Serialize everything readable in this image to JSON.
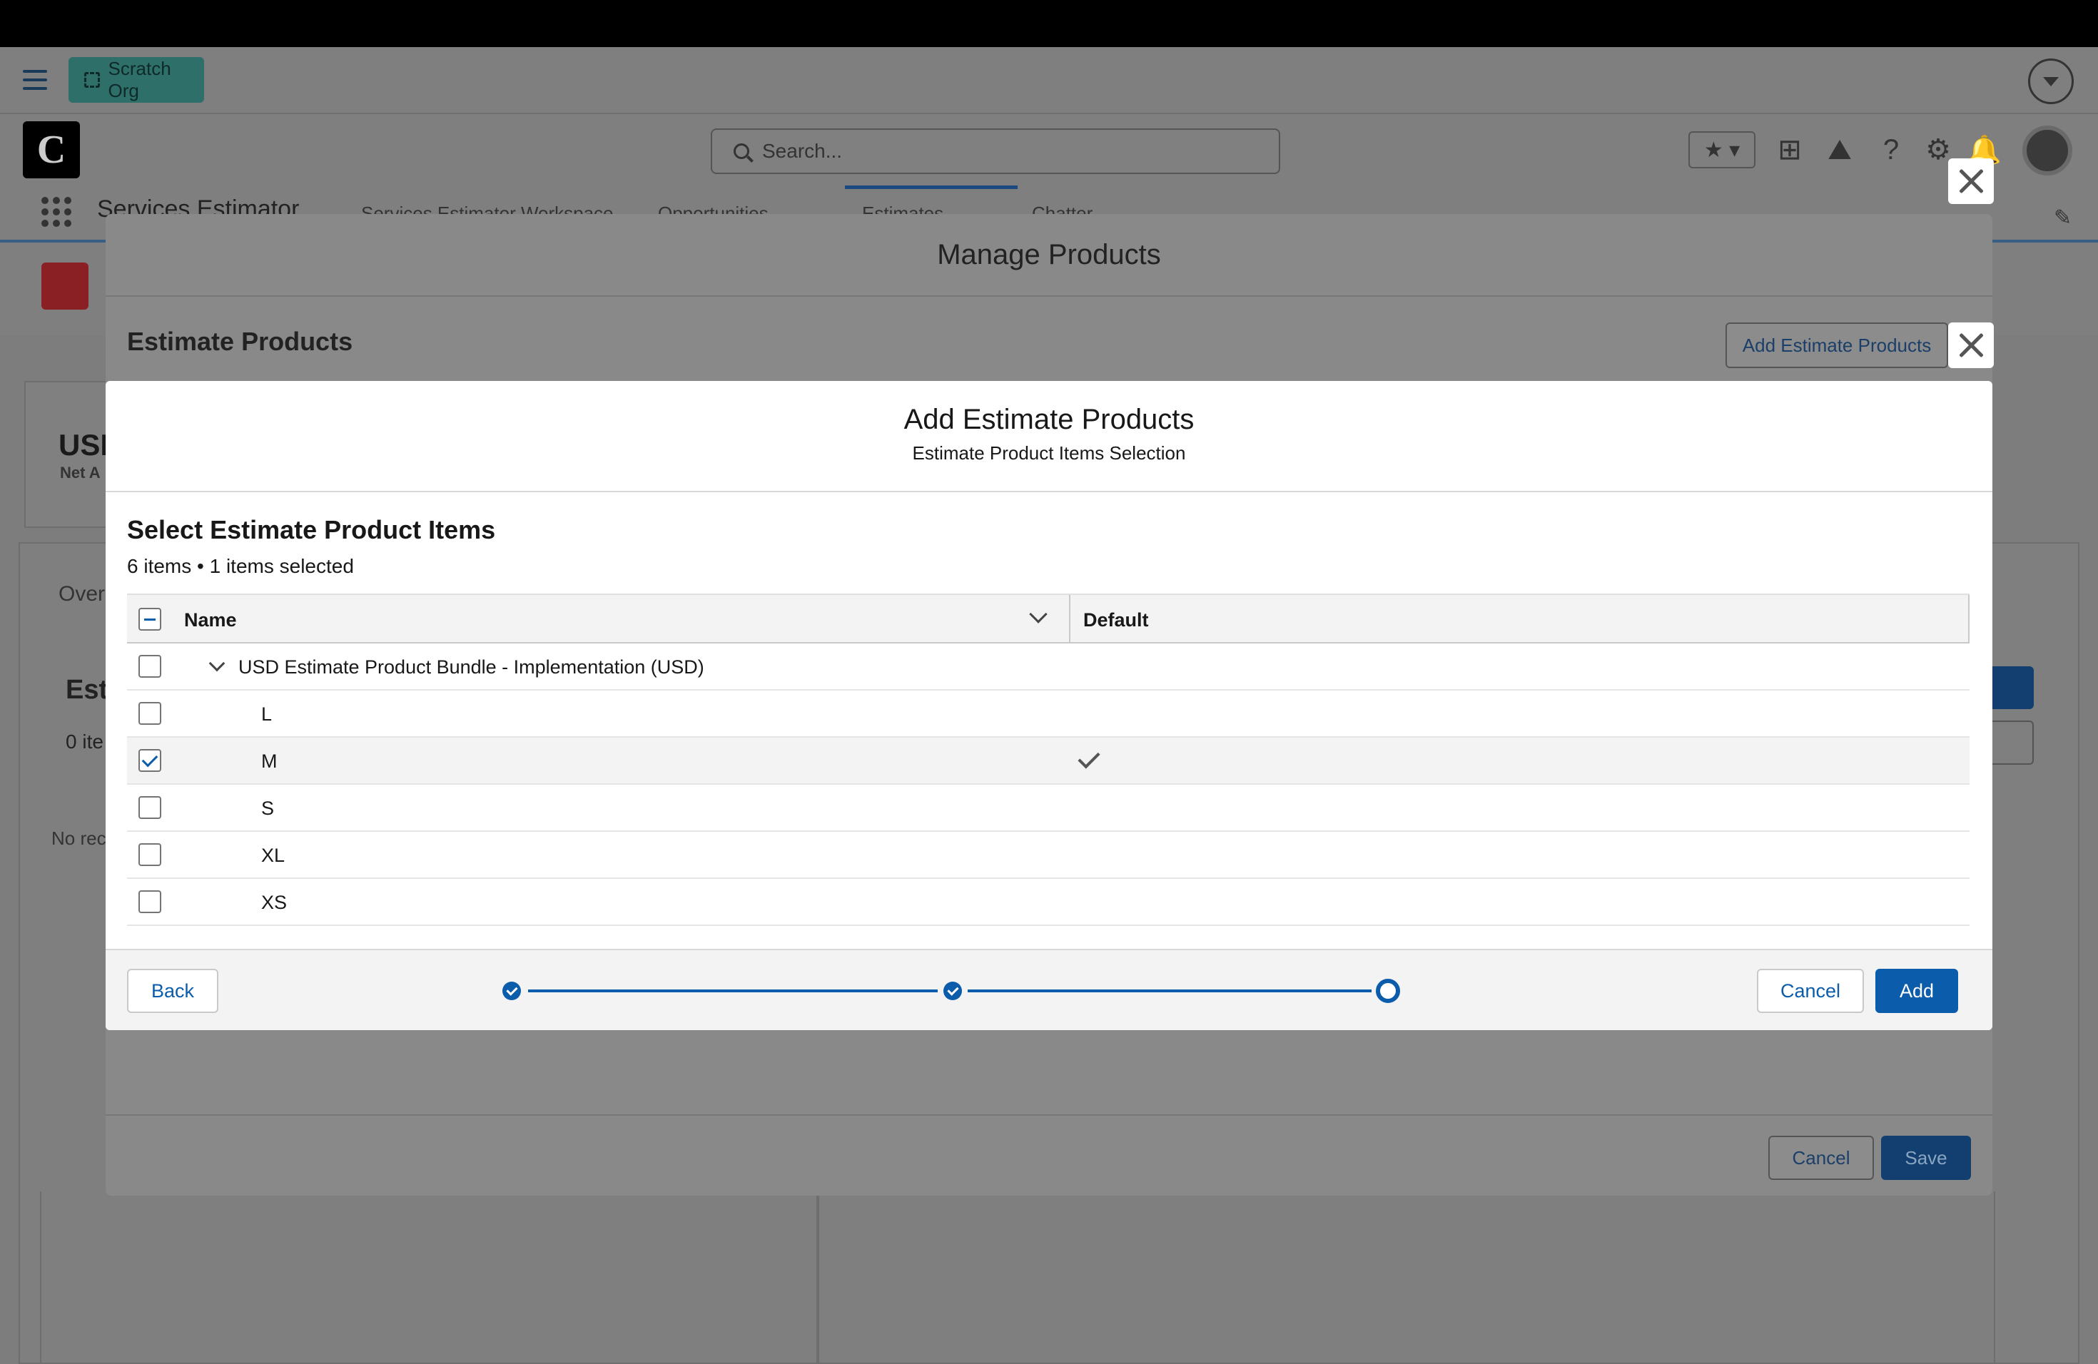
{
  "org": {
    "label": "Scratch Org"
  },
  "header": {
    "search_placeholder": "Search..."
  },
  "nav": {
    "app_name": "Services Estimator",
    "tabs": [
      "Services Estimator Workspace",
      "Opportunities",
      "Estimates",
      "Chatter"
    ]
  },
  "background": {
    "currency_label": "USI",
    "net_label": "Net A",
    "overview_tab": "Over",
    "estimate_label": "Est",
    "items_label": "0 ite",
    "no_records": "No rec"
  },
  "manage_products": {
    "title": "Manage Products",
    "section_title": "Estimate Products",
    "add_button": "Add Estimate Products",
    "cancel_label": "Cancel",
    "save_label": "Save"
  },
  "add_products": {
    "title": "Add Estimate Products",
    "subtitle": "Estimate Product Items Selection",
    "section_title": "Select Estimate Product Items",
    "count_text": "6 items • 1 items selected",
    "columns": {
      "name": "Name",
      "default": "Default"
    },
    "rows": [
      {
        "name": "USD Estimate Product Bundle - Implementation (USD)",
        "checked": false,
        "default": false,
        "parent": true
      },
      {
        "name": "L",
        "checked": false,
        "default": false
      },
      {
        "name": "M",
        "checked": true,
        "default": true
      },
      {
        "name": "S",
        "checked": false,
        "default": false
      },
      {
        "name": "XL",
        "checked": false,
        "default": false
      },
      {
        "name": "XS",
        "checked": false,
        "default": false
      }
    ],
    "back_label": "Back",
    "cancel_label": "Cancel",
    "add_label": "Add",
    "progress": {
      "total_steps": 3,
      "current_step": 3
    }
  },
  "colors": {
    "brand": "#0b5cab",
    "overlay": "#7f7f7f",
    "surface": "#ffffff",
    "header_fill": "#f3f3f3"
  }
}
